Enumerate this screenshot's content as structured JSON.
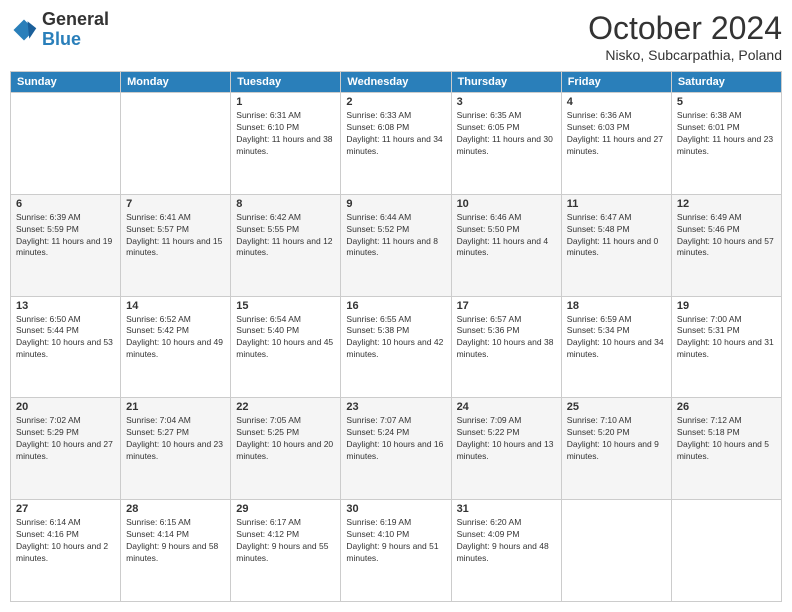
{
  "header": {
    "logo": {
      "general": "General",
      "blue": "Blue"
    },
    "title": "October 2024",
    "location": "Nisko, Subcarpathia, Poland"
  },
  "columns": [
    "Sunday",
    "Monday",
    "Tuesday",
    "Wednesday",
    "Thursday",
    "Friday",
    "Saturday"
  ],
  "weeks": [
    [
      {
        "day": "",
        "info": ""
      },
      {
        "day": "",
        "info": ""
      },
      {
        "day": "1",
        "info": "Sunrise: 6:31 AM\nSunset: 6:10 PM\nDaylight: 11 hours and 38 minutes."
      },
      {
        "day": "2",
        "info": "Sunrise: 6:33 AM\nSunset: 6:08 PM\nDaylight: 11 hours and 34 minutes."
      },
      {
        "day": "3",
        "info": "Sunrise: 6:35 AM\nSunset: 6:05 PM\nDaylight: 11 hours and 30 minutes."
      },
      {
        "day": "4",
        "info": "Sunrise: 6:36 AM\nSunset: 6:03 PM\nDaylight: 11 hours and 27 minutes."
      },
      {
        "day": "5",
        "info": "Sunrise: 6:38 AM\nSunset: 6:01 PM\nDaylight: 11 hours and 23 minutes."
      }
    ],
    [
      {
        "day": "6",
        "info": "Sunrise: 6:39 AM\nSunset: 5:59 PM\nDaylight: 11 hours and 19 minutes."
      },
      {
        "day": "7",
        "info": "Sunrise: 6:41 AM\nSunset: 5:57 PM\nDaylight: 11 hours and 15 minutes."
      },
      {
        "day": "8",
        "info": "Sunrise: 6:42 AM\nSunset: 5:55 PM\nDaylight: 11 hours and 12 minutes."
      },
      {
        "day": "9",
        "info": "Sunrise: 6:44 AM\nSunset: 5:52 PM\nDaylight: 11 hours and 8 minutes."
      },
      {
        "day": "10",
        "info": "Sunrise: 6:46 AM\nSunset: 5:50 PM\nDaylight: 11 hours and 4 minutes."
      },
      {
        "day": "11",
        "info": "Sunrise: 6:47 AM\nSunset: 5:48 PM\nDaylight: 11 hours and 0 minutes."
      },
      {
        "day": "12",
        "info": "Sunrise: 6:49 AM\nSunset: 5:46 PM\nDaylight: 10 hours and 57 minutes."
      }
    ],
    [
      {
        "day": "13",
        "info": "Sunrise: 6:50 AM\nSunset: 5:44 PM\nDaylight: 10 hours and 53 minutes."
      },
      {
        "day": "14",
        "info": "Sunrise: 6:52 AM\nSunset: 5:42 PM\nDaylight: 10 hours and 49 minutes."
      },
      {
        "day": "15",
        "info": "Sunrise: 6:54 AM\nSunset: 5:40 PM\nDaylight: 10 hours and 45 minutes."
      },
      {
        "day": "16",
        "info": "Sunrise: 6:55 AM\nSunset: 5:38 PM\nDaylight: 10 hours and 42 minutes."
      },
      {
        "day": "17",
        "info": "Sunrise: 6:57 AM\nSunset: 5:36 PM\nDaylight: 10 hours and 38 minutes."
      },
      {
        "day": "18",
        "info": "Sunrise: 6:59 AM\nSunset: 5:34 PM\nDaylight: 10 hours and 34 minutes."
      },
      {
        "day": "19",
        "info": "Sunrise: 7:00 AM\nSunset: 5:31 PM\nDaylight: 10 hours and 31 minutes."
      }
    ],
    [
      {
        "day": "20",
        "info": "Sunrise: 7:02 AM\nSunset: 5:29 PM\nDaylight: 10 hours and 27 minutes."
      },
      {
        "day": "21",
        "info": "Sunrise: 7:04 AM\nSunset: 5:27 PM\nDaylight: 10 hours and 23 minutes."
      },
      {
        "day": "22",
        "info": "Sunrise: 7:05 AM\nSunset: 5:25 PM\nDaylight: 10 hours and 20 minutes."
      },
      {
        "day": "23",
        "info": "Sunrise: 7:07 AM\nSunset: 5:24 PM\nDaylight: 10 hours and 16 minutes."
      },
      {
        "day": "24",
        "info": "Sunrise: 7:09 AM\nSunset: 5:22 PM\nDaylight: 10 hours and 13 minutes."
      },
      {
        "day": "25",
        "info": "Sunrise: 7:10 AM\nSunset: 5:20 PM\nDaylight: 10 hours and 9 minutes."
      },
      {
        "day": "26",
        "info": "Sunrise: 7:12 AM\nSunset: 5:18 PM\nDaylight: 10 hours and 5 minutes."
      }
    ],
    [
      {
        "day": "27",
        "info": "Sunrise: 6:14 AM\nSunset: 4:16 PM\nDaylight: 10 hours and 2 minutes."
      },
      {
        "day": "28",
        "info": "Sunrise: 6:15 AM\nSunset: 4:14 PM\nDaylight: 9 hours and 58 minutes."
      },
      {
        "day": "29",
        "info": "Sunrise: 6:17 AM\nSunset: 4:12 PM\nDaylight: 9 hours and 55 minutes."
      },
      {
        "day": "30",
        "info": "Sunrise: 6:19 AM\nSunset: 4:10 PM\nDaylight: 9 hours and 51 minutes."
      },
      {
        "day": "31",
        "info": "Sunrise: 6:20 AM\nSunset: 4:09 PM\nDaylight: 9 hours and 48 minutes."
      },
      {
        "day": "",
        "info": ""
      },
      {
        "day": "",
        "info": ""
      }
    ]
  ]
}
